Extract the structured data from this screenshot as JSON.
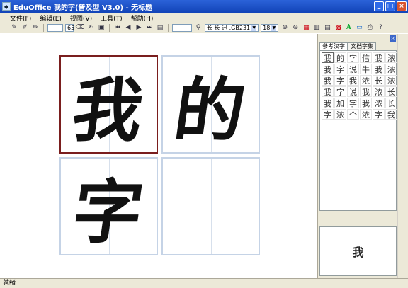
{
  "window": {
    "title": "EduOffice 我的字(普及型 V3.0) - 无标题",
    "icon": "app-icon"
  },
  "menu": [
    {
      "label": "文件(F)"
    },
    {
      "label": "编辑(E)"
    },
    {
      "label": "视图(V)"
    },
    {
      "label": "工具(T)"
    },
    {
      "label": "帮助(H)"
    }
  ],
  "toolbar": {
    "stroke_width": "65",
    "zoom_value": "",
    "font_name": "长 长 迅 .GB231",
    "font_size": "18"
  },
  "cells": [
    {
      "char": "我",
      "selected": true
    },
    {
      "char": "的",
      "selected": false
    },
    {
      "char": "字",
      "selected": false
    },
    {
      "char": "",
      "selected": false
    }
  ],
  "side_panel": {
    "tabs": [
      {
        "label": "参考汉字",
        "active": true
      },
      {
        "label": "文档字集",
        "active": false
      }
    ],
    "chars": [
      "我",
      "的",
      "字",
      "信",
      "我",
      "浓",
      "我",
      "字",
      "说",
      "牛",
      "我",
      "浓",
      "我",
      "字",
      "我",
      "浓",
      "长",
      "浓",
      "我",
      "字",
      "说",
      "我",
      "浓",
      "长",
      "我",
      "加",
      "字",
      "我",
      "浓",
      "长",
      "字",
      "浓",
      "个",
      "浓",
      "字",
      "我"
    ],
    "preview_char": "我"
  },
  "status": {
    "text": "就绪"
  },
  "colors": {
    "titlebar": "#1f54cc",
    "selected_cell_border": "#7a1e1e",
    "cell_border": "#c5d3e6"
  }
}
